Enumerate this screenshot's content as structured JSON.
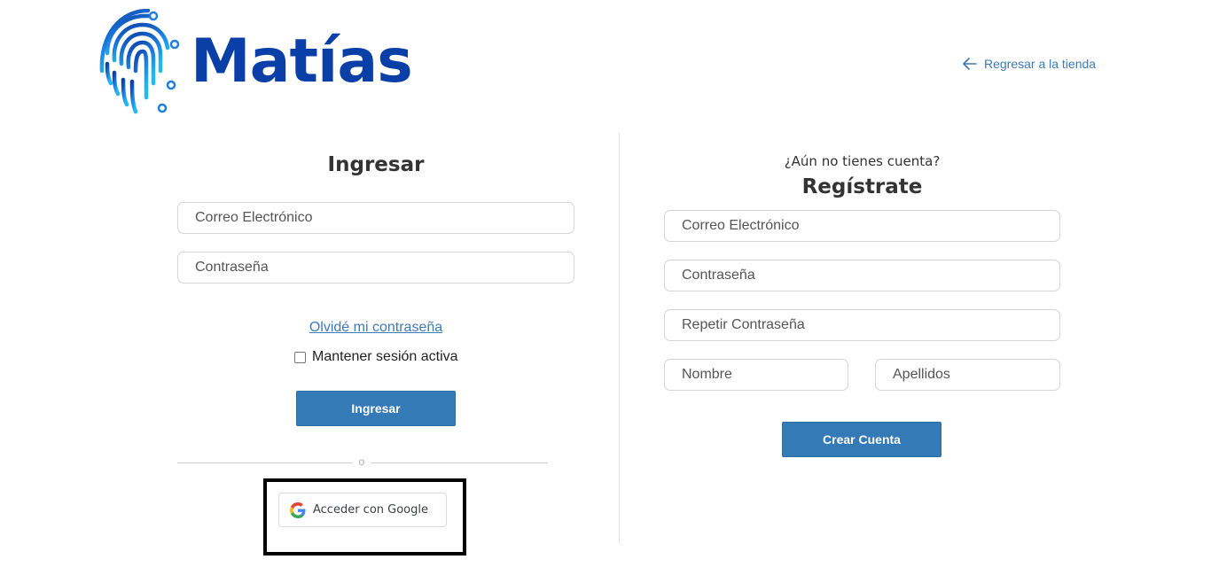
{
  "brand": {
    "name": "Matías",
    "logo_icon": "fingerprint-icon",
    "color": "#0b3fa8"
  },
  "header": {
    "back_link": "Regresar a la tienda",
    "back_icon": "arrow-left-icon"
  },
  "login": {
    "title": "Ingresar",
    "email_placeholder": "Correo Electrónico",
    "password_placeholder": "Contraseña",
    "forgot_link": "Olvidé mi contraseña",
    "keep_session": "Mantener sesión activa",
    "keep_session_checked": false,
    "submit_label": "Ingresar",
    "or_text": "o",
    "google_label": "Acceder con Google",
    "google_icon": "google-g-icon"
  },
  "register": {
    "question": "¿Aún no tienes cuenta?",
    "title": "Regístrate",
    "email_placeholder": "Correo Electrónico",
    "password_placeholder": "Contraseña",
    "repeat_password_placeholder": "Repetir Contraseña",
    "first_name_placeholder": "Nombre",
    "last_name_placeholder": "Apellidos",
    "submit_label": "Crear Cuenta"
  },
  "colors": {
    "accent": "#337ab7",
    "link": "#3d7ab8"
  }
}
